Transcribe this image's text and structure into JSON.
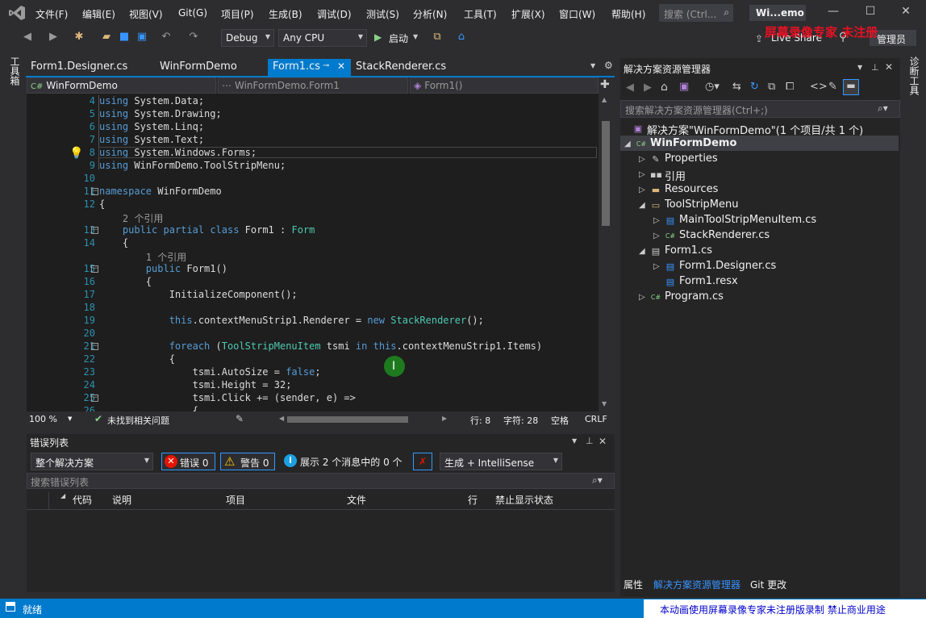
{
  "menubar": {
    "items": [
      "文件(F)",
      "编辑(E)",
      "视图(V)",
      "Git(G)",
      "项目(P)",
      "生成(B)",
      "调试(D)",
      "测试(S)",
      "分析(N)",
      "工具(T)",
      "扩展(X)",
      "窗口(W)",
      "帮助(H)"
    ],
    "search_placeholder": "搜索 (Ctrl...",
    "window_title": "Wi...emo"
  },
  "toolbar": {
    "config": "Debug",
    "platform": "Any CPU",
    "start_label": "启动",
    "live_share": "Live Share",
    "admin": "管理员",
    "watermark": "屏幕录像专家 未注册"
  },
  "left_strip": {
    "label": "工具箱"
  },
  "right_strip": {
    "label": "诊断工具"
  },
  "doc_tabs": [
    "Form1.Designer.cs",
    "WinFormDemo",
    "Form1.cs",
    "StackRenderer.cs"
  ],
  "navbar": {
    "project": "WinFormDemo",
    "class": "WinFormDemo.Form1",
    "member": "Form1()"
  },
  "code_lines": [
    {
      "n": "4",
      "t": "using System.Data;"
    },
    {
      "n": "5",
      "t": "using System.Drawing;"
    },
    {
      "n": "6",
      "t": "using System.Linq;"
    },
    {
      "n": "7",
      "t": "using System.Text;"
    },
    {
      "n": "8",
      "t": "using System.Windows.Forms;"
    },
    {
      "n": "9",
      "t": "using WinFormDemo.ToolStripMenu;"
    },
    {
      "n": "10",
      "t": ""
    },
    {
      "n": "11",
      "t": "namespace WinFormDemo"
    },
    {
      "n": "12",
      "t": "{"
    },
    {
      "n": "",
      "t": "    2 个引用"
    },
    {
      "n": "13",
      "t": "    public partial class Form1 : Form"
    },
    {
      "n": "14",
      "t": "    {"
    },
    {
      "n": "",
      "t": "        1 个引用"
    },
    {
      "n": "15",
      "t": "        public Form1()"
    },
    {
      "n": "16",
      "t": "        {"
    },
    {
      "n": "17",
      "t": "            InitializeComponent();"
    },
    {
      "n": "18",
      "t": ""
    },
    {
      "n": "19",
      "t": "            this.contextMenuStrip1.Renderer = new StackRenderer();"
    },
    {
      "n": "20",
      "t": ""
    },
    {
      "n": "21",
      "t": "            foreach (ToolStripMenuItem tsmi in this.contextMenuStrip1.Items)"
    },
    {
      "n": "22",
      "t": "            {"
    },
    {
      "n": "23",
      "t": "                tsmi.AutoSize = false;"
    },
    {
      "n": "24",
      "t": "                tsmi.Height = 32;"
    },
    {
      "n": "25",
      "t": "                tsmi.Click += (sender, e) =>"
    },
    {
      "n": "26",
      "t": "                {"
    }
  ],
  "editor_status": {
    "zoom": "100 %",
    "issues": "未找到相关问题",
    "line": "行: 8",
    "col": "字符: 28",
    "ws": "空格",
    "eol": "CRLF"
  },
  "errlist": {
    "title": "错误列表",
    "scope": "整个解决方案",
    "errors": "错误 0",
    "warnings": "警告 0",
    "messages": "展示 2 个消息中的 0 个",
    "build_filter": "生成 + IntelliSense",
    "search_placeholder": "搜索错误列表",
    "columns": [
      "代码",
      "说明",
      "项目",
      "文件",
      "行",
      "禁止显示状态"
    ]
  },
  "solexp": {
    "title": "解决方案资源管理器",
    "search_placeholder": "搜索解决方案资源管理器(Ctrl+;)",
    "tree": [
      {
        "label": "解决方案\"WinFormDemo\"(1 个项目/共 1 个)",
        "depth": 0,
        "icon": "solution-icon",
        "tri": ""
      },
      {
        "label": "WinFormDemo",
        "depth": 0,
        "icon": "csharp-project-icon",
        "tri": "open",
        "bold": true
      },
      {
        "label": "Properties",
        "depth": 1,
        "icon": "wrench-icon",
        "tri": "closed"
      },
      {
        "label": "引用",
        "depth": 1,
        "icon": "references-icon",
        "tri": "closed"
      },
      {
        "label": "Resources",
        "depth": 1,
        "icon": "folder-icon",
        "tri": "closed"
      },
      {
        "label": "ToolStripMenu",
        "depth": 1,
        "icon": "folder-open-icon",
        "tri": "open"
      },
      {
        "label": "MainToolStripMenuItem.cs",
        "depth": 2,
        "icon": "csfile-icon",
        "tri": "closed"
      },
      {
        "label": "StackRenderer.cs",
        "depth": 2,
        "icon": "csharp-file-icon",
        "tri": "closed"
      },
      {
        "label": "Form1.cs",
        "depth": 1,
        "icon": "form-icon",
        "tri": "open"
      },
      {
        "label": "Form1.Designer.cs",
        "depth": 2,
        "icon": "csfile-icon",
        "tri": "closed"
      },
      {
        "label": "Form1.resx",
        "depth": 2,
        "icon": "resx-icon",
        "tri": ""
      },
      {
        "label": "Program.cs",
        "depth": 1,
        "icon": "csharp-file-icon",
        "tri": "closed"
      }
    ],
    "bottom_tabs": [
      "属性",
      "解决方案资源管理器",
      "Git 更改"
    ]
  },
  "statusbar": {
    "ready": "就绪",
    "watermark": "本动画使用屏幕录像专家未注册版录制 禁止商业用途"
  }
}
